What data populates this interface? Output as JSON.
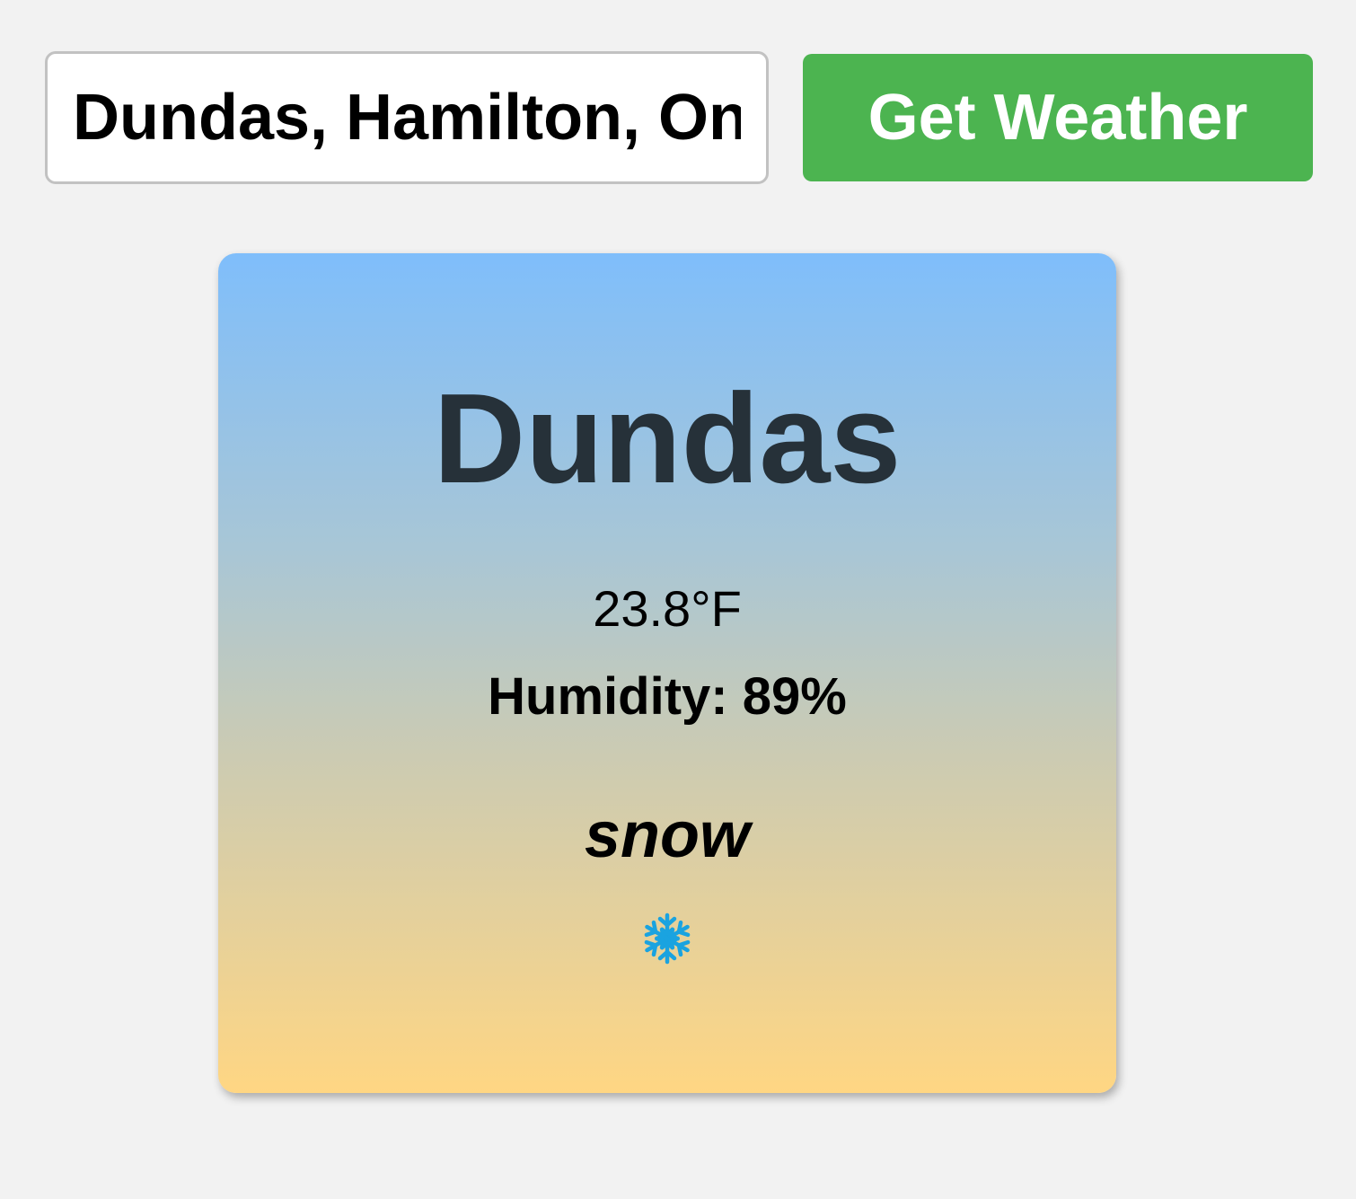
{
  "search": {
    "value": "Dundas, Hamilton, Ontario, Canada",
    "button_label": "Get Weather"
  },
  "weather": {
    "city": "Dundas",
    "temperature": "23.8°F",
    "humidity_label": "Humidity:",
    "humidity_value": "89%",
    "description": "snow",
    "icon": "snowflake-icon"
  },
  "colors": {
    "button": "#4cb450",
    "card_top": "#7fbefb",
    "card_bottom": "#ffd683",
    "city_text": "#263139",
    "icon": "#1aa3e0"
  }
}
